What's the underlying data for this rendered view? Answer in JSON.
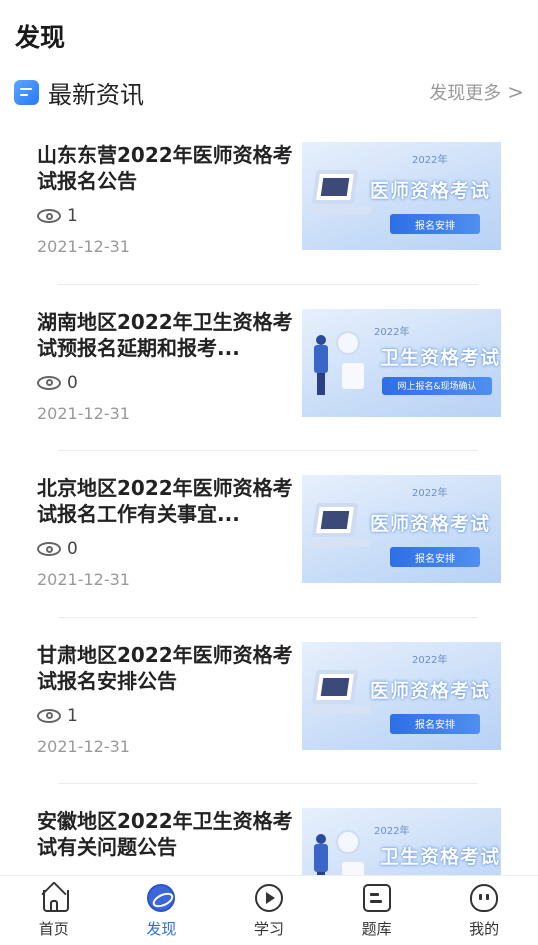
{
  "page": {
    "title": "发现"
  },
  "section": {
    "title": "最新资讯",
    "more": "发现更多",
    "more_chevron": ">"
  },
  "news": [
    {
      "title": "山东东营2022年医师资格考试报名公告",
      "views": "1",
      "date": "2021-12-31",
      "thumb": {
        "style": "a",
        "year": "2022年",
        "headline": "医师资格考试",
        "tag": "报名安排"
      }
    },
    {
      "title": "湖南地区2022年卫生资格考试预报名延期和报考...",
      "views": "0",
      "date": "2021-12-31",
      "thumb": {
        "style": "b",
        "year": "2022年",
        "headline": "卫生资格考试",
        "tag": "网上报名&现场确认"
      }
    },
    {
      "title": "北京地区2022年医师资格考试报名工作有关事宜...",
      "views": "0",
      "date": "2021-12-31",
      "thumb": {
        "style": "a",
        "year": "2022年",
        "headline": "医师资格考试",
        "tag": "报名安排"
      }
    },
    {
      "title": "甘肃地区2022年医师资格考试报名安排公告",
      "views": "1",
      "date": "2021-12-31",
      "thumb": {
        "style": "a",
        "year": "2022年",
        "headline": "医师资格考试",
        "tag": "报名安排"
      }
    },
    {
      "title": "安徽地区2022年卫生资格考试有关问题公告",
      "views": "",
      "date": "",
      "thumb": {
        "style": "b",
        "year": "2022年",
        "headline": "卫生资格考试",
        "tag": ""
      }
    }
  ],
  "tabbar": {
    "tabs": [
      {
        "label": "首页",
        "icon": "home-icon",
        "active": false
      },
      {
        "label": "发现",
        "icon": "discover-icon",
        "active": true
      },
      {
        "label": "学习",
        "icon": "play-circle-icon",
        "active": false
      },
      {
        "label": "题库",
        "icon": "question-bank-icon",
        "active": false
      },
      {
        "label": "我的",
        "icon": "profile-icon",
        "active": false
      }
    ]
  },
  "colors": {
    "accent": "#2a6fe0",
    "muted": "#999999"
  }
}
